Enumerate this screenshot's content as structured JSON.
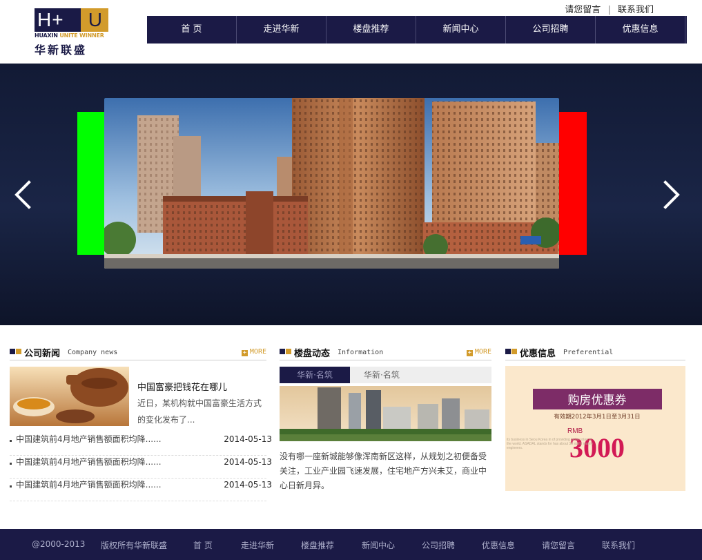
{
  "brand": {
    "logo_letters_left": "H+",
    "logo_letter_right": "U",
    "logo_sub_a": "HUAXIN",
    "logo_sub_b": "UNITE WINNER",
    "logo_cn": "华新联盛"
  },
  "toplinks": {
    "message": "请您留言",
    "sep": "|",
    "contact": "联系我们"
  },
  "nav": [
    "首 页",
    "走进华新",
    "楼盘推荐",
    "新闻中心",
    "公司招聘",
    "优惠信息"
  ],
  "news": {
    "title_cn": "公司新闻",
    "title_en": "Company news",
    "more": "MORE",
    "feature_title": "中国富豪把钱花在哪儿",
    "feature_desc": "近日，某机构就中国富豪生活方式的变化发布了...",
    "items": [
      {
        "text": "中国建筑前4月地产销售额面积均降......",
        "date": "2014-05-13"
      },
      {
        "text": "中国建筑前4月地产销售额面积均降......",
        "date": "2014-05-13"
      },
      {
        "text": "中国建筑前4月地产销售额面积均降......",
        "date": "2014-05-13"
      }
    ]
  },
  "info": {
    "title_cn": "楼盘动态",
    "title_en": "Information",
    "more": "MORE",
    "tab_active": "华新·名筑",
    "tab_inactive": "华新·名筑",
    "desc": "没有哪一座新城能够像浑南新区这样，从规划之初便备受关注，工业产业园飞速发展，住宅地产方兴未艾，商业中心日新月异。"
  },
  "pref": {
    "title_cn": "优惠信息",
    "title_en": "Preferential",
    "coupon_title": "购房优惠券",
    "coupon_valid": "有效期2012年3月1日至3月31日",
    "coupon_currency": "RMB",
    "coupon_amount": "3000",
    "coupon_bg_text_1": "its business in Seou Korea in   of providing better internat",
    "coupon_bg_text_2": "the world. ASADAL stands for      has about 30 staffs mainly",
    "coupon_bg_text_3": "                                   engineers."
  },
  "footer": {
    "copyright": "@2000-2013",
    "rights": "版权所有华新联盛",
    "links": [
      "首 页",
      "走进华新",
      "楼盘推荐",
      "新闻中心",
      "公司招聘",
      "优惠信息",
      "请您留言",
      "联系我们"
    ]
  },
  "colors": {
    "navy": "#1b1a46",
    "gold": "#d29b2b",
    "green_bar": "#00ff00",
    "red_bar": "#ff0000"
  }
}
